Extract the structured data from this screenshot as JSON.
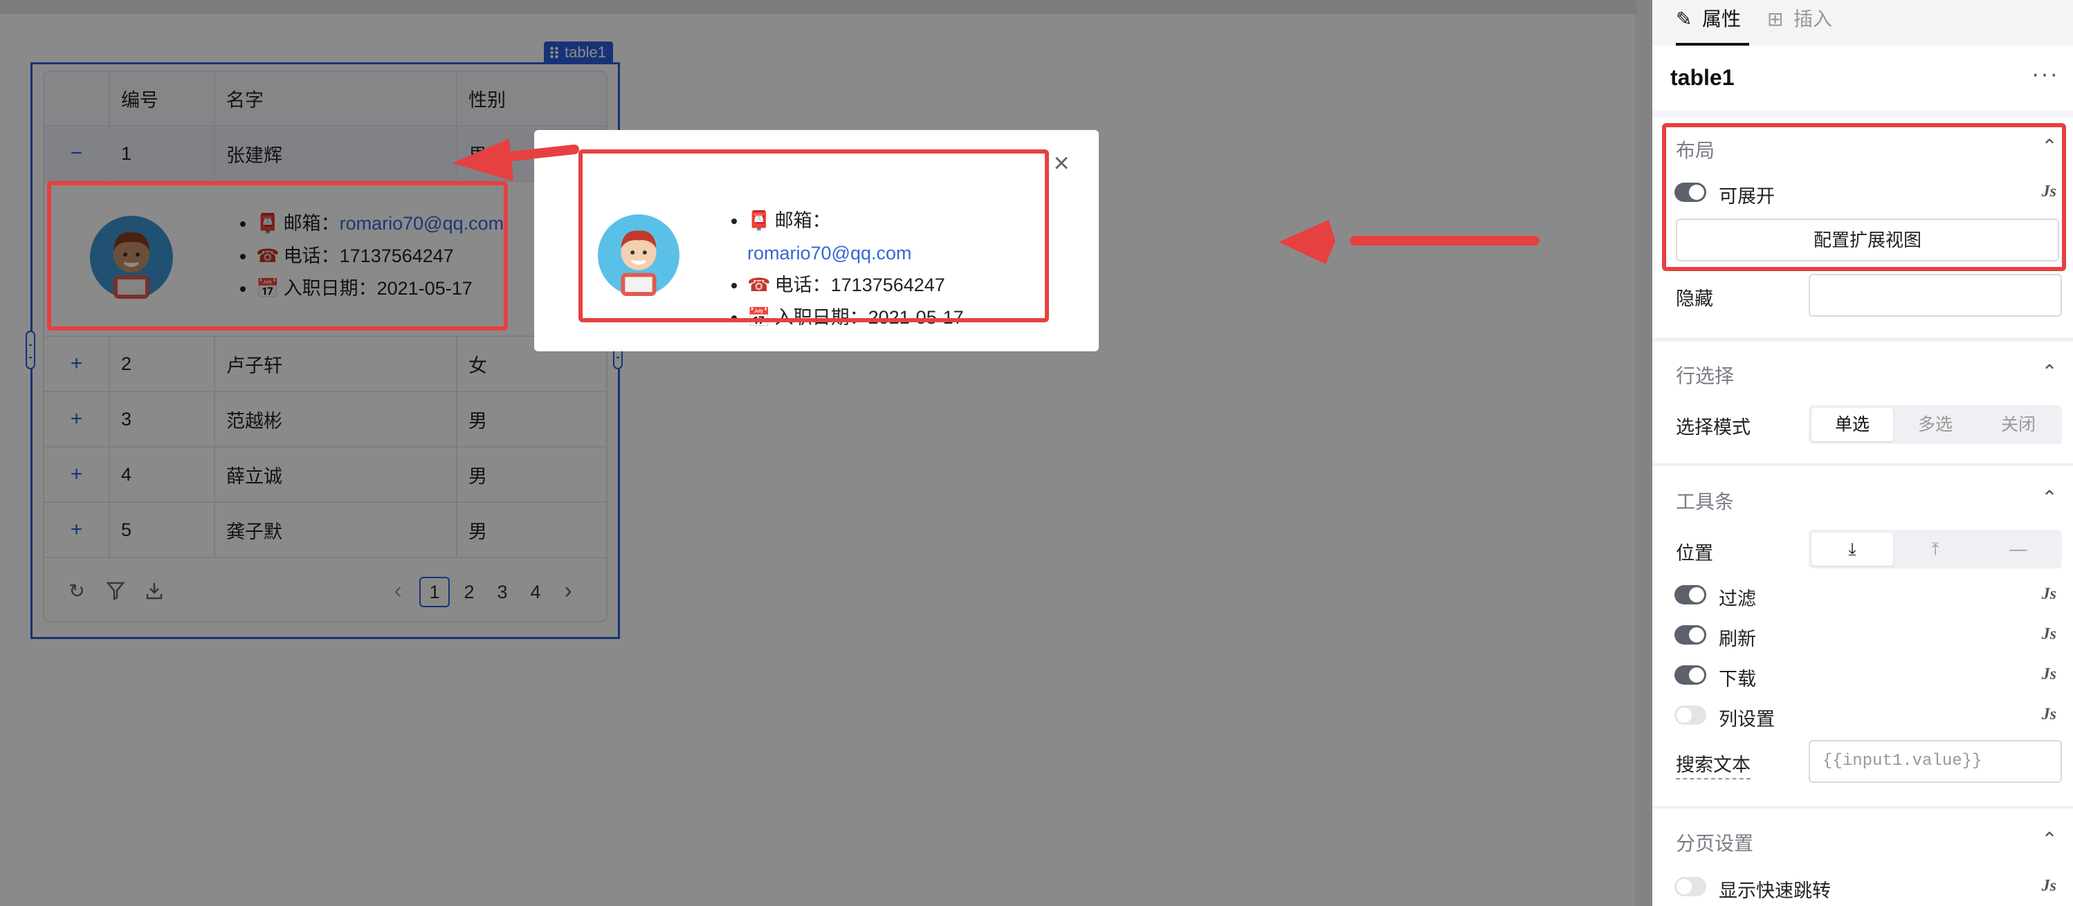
{
  "canvas": {
    "component_tag": "table1",
    "table": {
      "columns": [
        "",
        "编号",
        "名字",
        "性别"
      ],
      "rows": [
        {
          "expand": "−",
          "id": "1",
          "name": "张建辉",
          "gender": "男"
        },
        {
          "expand": "+",
          "id": "2",
          "name": "卢子轩",
          "gender": "女"
        },
        {
          "expand": "+",
          "id": "3",
          "name": "范越彬",
          "gender": "男"
        },
        {
          "expand": "+",
          "id": "4",
          "name": "薛立诚",
          "gender": "男"
        },
        {
          "expand": "+",
          "id": "5",
          "name": "龚子默",
          "gender": "男"
        }
      ],
      "expanded_detail": {
        "email_label": "邮箱：",
        "email": "romario70@qq.com",
        "phone_label": "电话：",
        "phone": "17137564247",
        "hire_label": "入职日期：",
        "hire_date": "2021-05-17"
      }
    },
    "pagination": {
      "pages": [
        "1",
        "2",
        "3",
        "4"
      ],
      "current": "1"
    }
  },
  "modal": {
    "email_label": "邮箱：",
    "email": "romario70@qq.com",
    "phone_label": "电话：",
    "phone": "17137564247",
    "hire_label": "入职日期：",
    "hire_date": "2021-05-17"
  },
  "panel": {
    "tabs": [
      {
        "label": "属性",
        "icon": "edit-icon"
      },
      {
        "label": "插入",
        "icon": "insert-icon"
      }
    ],
    "component_name": "table1",
    "sections": {
      "layout": {
        "title": "布局",
        "expandable_label": "可展开",
        "config_button": "配置扩展视图",
        "hidden_label": "隐藏"
      },
      "row_select": {
        "title": "行选择",
        "mode_label": "选择模式",
        "modes": [
          "单选",
          "多选",
          "关闭"
        ],
        "selected_mode": "单选"
      },
      "toolbar": {
        "title": "工具条",
        "position_label": "位置",
        "filter_label": "过滤",
        "refresh_label": "刷新",
        "download_label": "下载",
        "columns_label": "列设置",
        "search_label": "搜索文本",
        "search_placeholder": "{{input1.value}}"
      },
      "pagination": {
        "title": "分页设置",
        "quick_jump_label": "显示快速跳转"
      }
    },
    "js_badge": "Js"
  },
  "colors": {
    "accent": "#2b5fdc",
    "highlight": "#e74040",
    "toggle_on": "#5d616b"
  }
}
